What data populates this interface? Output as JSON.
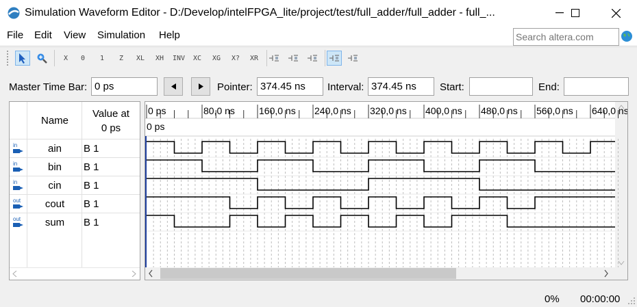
{
  "window": {
    "title": "Simulation Waveform Editor - D:/Develop/intelFPGA_lite/project/test/full_adder/full_adder - full_...",
    "minimize": "—",
    "maximize": "☐",
    "close": "✕"
  },
  "menu": {
    "items": [
      "File",
      "Edit",
      "View",
      "Simulation",
      "Help"
    ]
  },
  "search": {
    "placeholder": "Search altera.com"
  },
  "toolbar": {
    "icons": [
      "selection-tool-icon",
      "zoom-tool-icon",
      "force-unknown-icon",
      "force-low-icon",
      "force-high-icon",
      "force-high-impedance-icon",
      "force-weak-low-icon",
      "force-weak-high-icon",
      "invert-icon",
      "count-value-icon",
      "overwrite-clock-icon",
      "random-values-icon",
      "dont-care-icon",
      "snap-to-grid-icon",
      "align-icon",
      "arrange-icon",
      "overwrite-icon",
      "grid-icon"
    ],
    "labels": [
      "",
      "",
      "X",
      "0",
      "1",
      "Z",
      "XL",
      "XH",
      "INV",
      "XC",
      "XG",
      "X?",
      "XR",
      "",
      "",
      "",
      "",
      ""
    ]
  },
  "timebar": {
    "master_label": "Master Time Bar:",
    "master_value": "0 ps",
    "prev": "◀",
    "next": "▶",
    "pointer_label": "Pointer:",
    "pointer_value": "374.45 ns",
    "interval_label": "Interval:",
    "interval_value": "374.45 ns",
    "start_label": "Start:",
    "start_value": "",
    "end_label": "End:",
    "end_value": ""
  },
  "table": {
    "name_header": "Name",
    "value_header_line1": "Value at",
    "value_header_line2": "0 ps",
    "signals": [
      {
        "dir": "in",
        "name": "ain",
        "value": "B 1",
        "transitions": [
          0,
          40,
          80,
          120,
          160,
          200,
          240,
          280,
          320,
          360,
          400,
          440,
          480,
          520,
          560,
          600,
          640
        ]
      },
      {
        "dir": "in",
        "name": "bin",
        "value": "B 1",
        "transitions": [
          0,
          80,
          160,
          240,
          320,
          400,
          480,
          560
        ]
      },
      {
        "dir": "in",
        "name": "cin",
        "value": "B 1",
        "transitions": [
          0,
          160,
          320,
          480
        ]
      },
      {
        "dir": "out",
        "name": "cout",
        "value": "B 1",
        "transitions": [
          0,
          120,
          160,
          200,
          240,
          280,
          320,
          360,
          400,
          440,
          480,
          520,
          560
        ]
      },
      {
        "dir": "out",
        "name": "sum",
        "value": "B 1",
        "transitions": [
          0,
          40,
          120,
          160,
          200,
          240,
          280,
          320,
          360,
          400,
          440,
          520
        ]
      }
    ]
  },
  "timeline": {
    "cursor_label": "0 ps",
    "ticks": [
      "0 ps",
      "80,0 ns",
      "160,0 ns",
      "240,0 ns",
      "320,0 ns",
      "400,0 ns",
      "480,0 ns",
      "560,0 ns",
      "640,0 ns"
    ],
    "tick_values_ns": [
      0,
      80,
      160,
      240,
      320,
      400,
      480,
      560,
      640
    ]
  },
  "status": {
    "progress": "0%",
    "elapsed": "00:00:00"
  }
}
